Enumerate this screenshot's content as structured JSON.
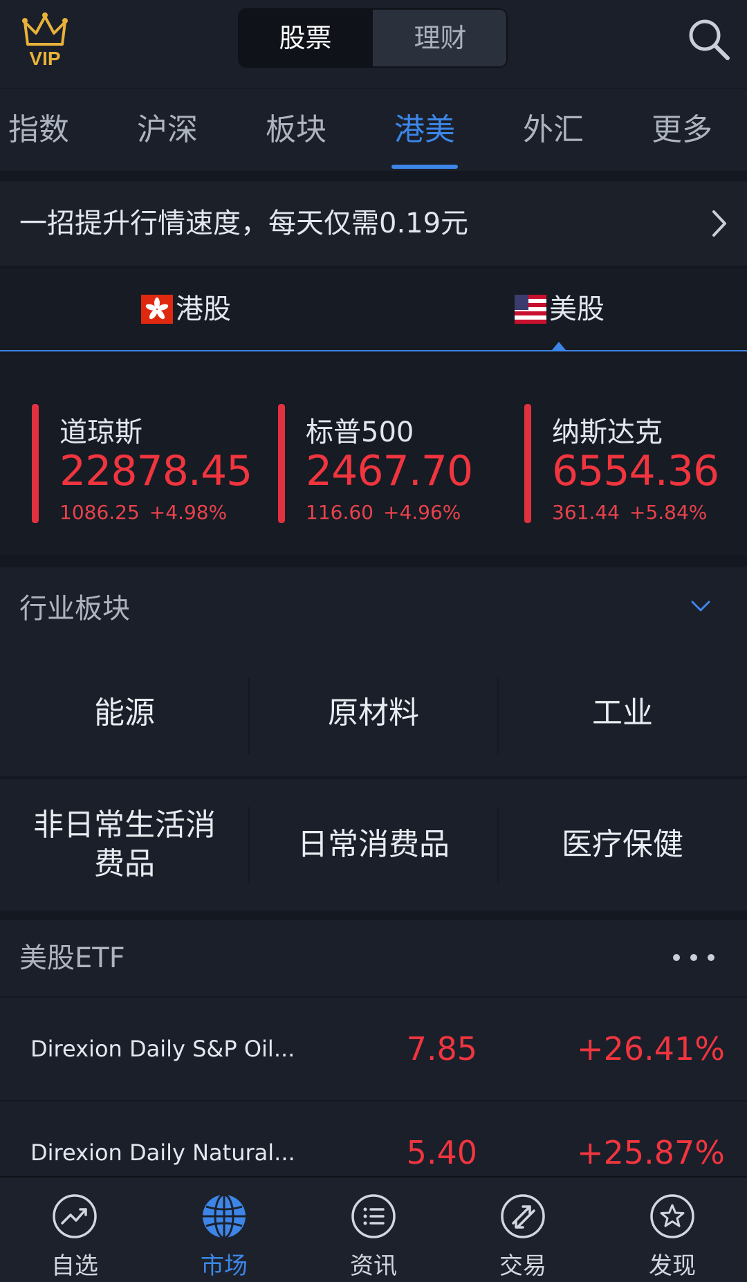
{
  "header": {
    "vip_label": "VIP",
    "segments": [
      "股票",
      "理财"
    ],
    "active_segment": 0
  },
  "tabs": [
    "指数",
    "沪深",
    "板块",
    "港美",
    "外汇",
    "更多"
  ],
  "active_tab": 3,
  "promo": {
    "text": "一招提升行情速度，每天仅需0.19元"
  },
  "market": {
    "hk_label": "港股",
    "us_label": "美股",
    "active": "us"
  },
  "indices": [
    {
      "name": "道琼斯",
      "value": "22878.45",
      "change": "1086.25",
      "pct": "+4.98%"
    },
    {
      "name": "标普500",
      "value": "2467.70",
      "change": "116.60",
      "pct": "+4.96%"
    },
    {
      "name": "纳斯达克",
      "value": "6554.36",
      "change": "361.44",
      "pct": "+5.84%"
    }
  ],
  "sectors": {
    "title": "行业板块",
    "rows": [
      [
        "能源",
        "原材料",
        "工业"
      ],
      [
        "非日常生活消费品",
        "日常消费品",
        "医疗保健"
      ]
    ]
  },
  "etf": {
    "title": "美股ETF",
    "items": [
      {
        "name": "Direxion Daily S&P Oil...",
        "price": "7.85",
        "pct": "+26.41%"
      },
      {
        "name": "Direxion Daily Natural...",
        "price": "5.40",
        "pct": "+25.87%"
      }
    ]
  },
  "bottom_nav": [
    {
      "label": "自选",
      "icon": "trend-chart-icon"
    },
    {
      "label": "市场",
      "icon": "globe-icon"
    },
    {
      "label": "资讯",
      "icon": "list-icon"
    },
    {
      "label": "交易",
      "icon": "trade-icon"
    },
    {
      "label": "发现",
      "icon": "star-icon"
    }
  ],
  "active_nav": 1,
  "colors": {
    "accent": "#3d86e8",
    "up": "#f0353f",
    "background": "#141821",
    "gold": "#e8b23a"
  }
}
